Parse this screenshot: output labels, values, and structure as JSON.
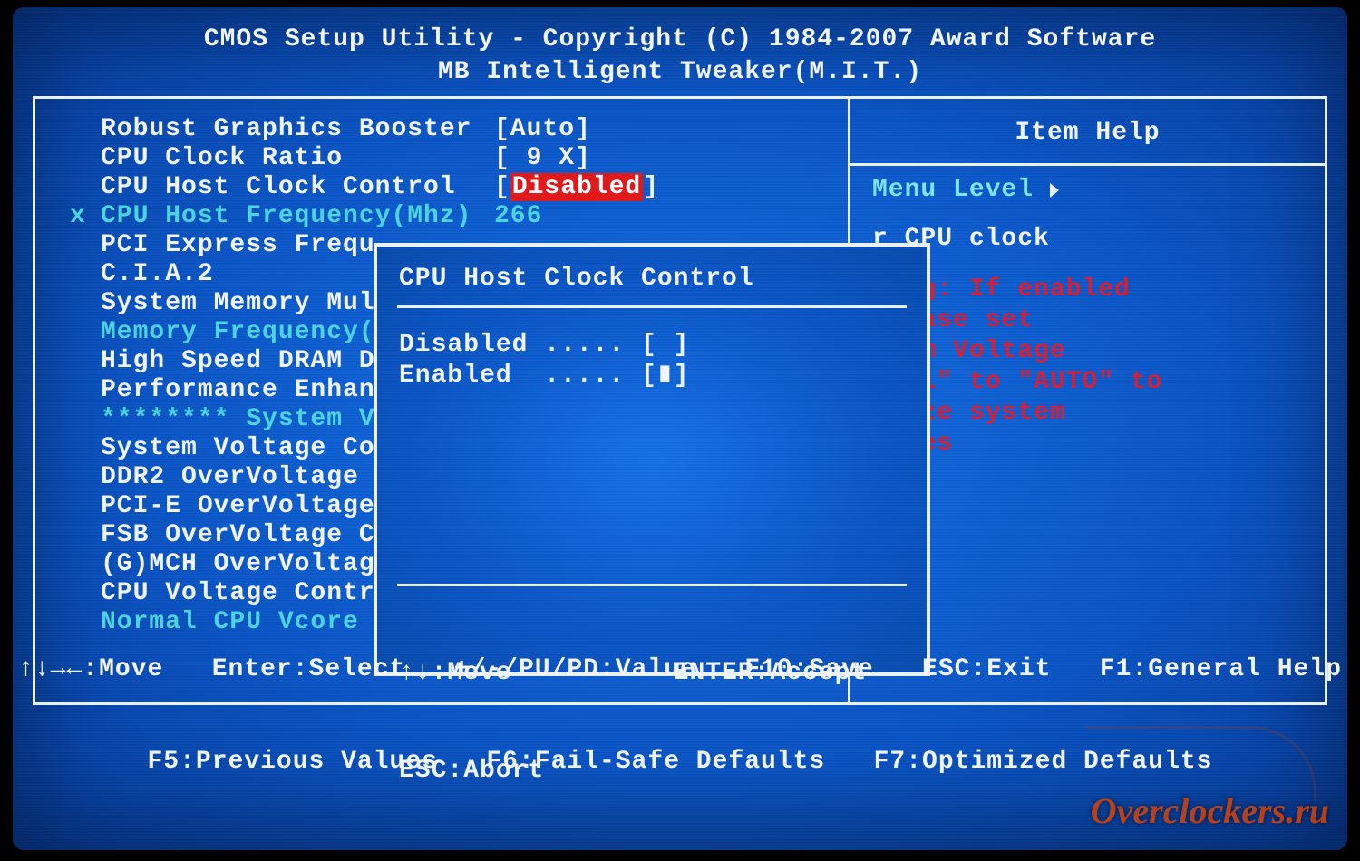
{
  "header": {
    "line1": "CMOS Setup Utility - Copyright (C) 1984-2007 Award Software",
    "line2": "MB Intelligent Tweaker(M.I.T.)"
  },
  "settings": [
    {
      "label": "Robust Graphics Booster",
      "value": "[Auto]",
      "cls": ""
    },
    {
      "label": "CPU Clock Ratio",
      "value": "[ 9 X]",
      "cls": ""
    },
    {
      "label": "CPU Host Clock Control",
      "value": "[",
      "cls": "",
      "hival": "Disabled",
      "post": "]"
    },
    {
      "label": "CPU Host Frequency(Mhz)",
      "value": "266",
      "cls": "cyan",
      "prefix": "x"
    },
    {
      "label": "PCI Express Frequ",
      "value": "",
      "cls": ""
    },
    {
      "label": "C.I.A.2",
      "value": "",
      "cls": ""
    },
    {
      "label": "System Memory Mul",
      "value": "",
      "cls": ""
    },
    {
      "label": "Memory Frequency(",
      "value": "",
      "cls": "cyan"
    },
    {
      "label": "High Speed DRAM D",
      "value": "",
      "cls": ""
    },
    {
      "label": "Performance Enhan",
      "value": "",
      "cls": ""
    },
    {
      "label": "******** System V",
      "value": "",
      "cls": "stars"
    },
    {
      "label": "System Voltage Co",
      "value": "",
      "cls": ""
    },
    {
      "label": "DDR2 OverVoltage",
      "value": "",
      "cls": ""
    },
    {
      "label": "PCI-E OverVoltage",
      "value": "",
      "cls": ""
    },
    {
      "label": "FSB OverVoltage C",
      "value": "",
      "cls": ""
    },
    {
      "label": "(G)MCH OverVoltag",
      "value": "",
      "cls": ""
    },
    {
      "label": "CPU Voltage Contr",
      "value": "",
      "cls": ""
    },
    {
      "label": "Normal CPU Vcore",
      "value": "",
      "cls": "cyan"
    }
  ],
  "help": {
    "title": "Item Help",
    "menu_level": "Menu Level",
    "text1": "r CPU clock",
    "warn_lines": [
      "ning: If enabled",
      " please set",
      "stem Voltage",
      "trol\" to \"AUTO\" to",
      "imize system",
      "tages"
    ]
  },
  "popup": {
    "title": "CPU Host Clock Control",
    "options": [
      {
        "label": "Disabled ..... [ ]",
        "selected": false
      },
      {
        "label": "Enabled  ..... [∎]",
        "selected": true
      }
    ],
    "foot1": "↑↓:Move          ENTER:Accept",
    "foot2": "ESC:Abort"
  },
  "footer": {
    "line1": "↑↓→←:Move   Enter:Select   +/-/PU/PD:Value   F10:Save   ESC:Exit   F1:General Help",
    "line2": "F5:Previous Values   F6:Fail-Safe Defaults   F7:Optimized Defaults"
  },
  "watermark": "Overclockers.ru"
}
